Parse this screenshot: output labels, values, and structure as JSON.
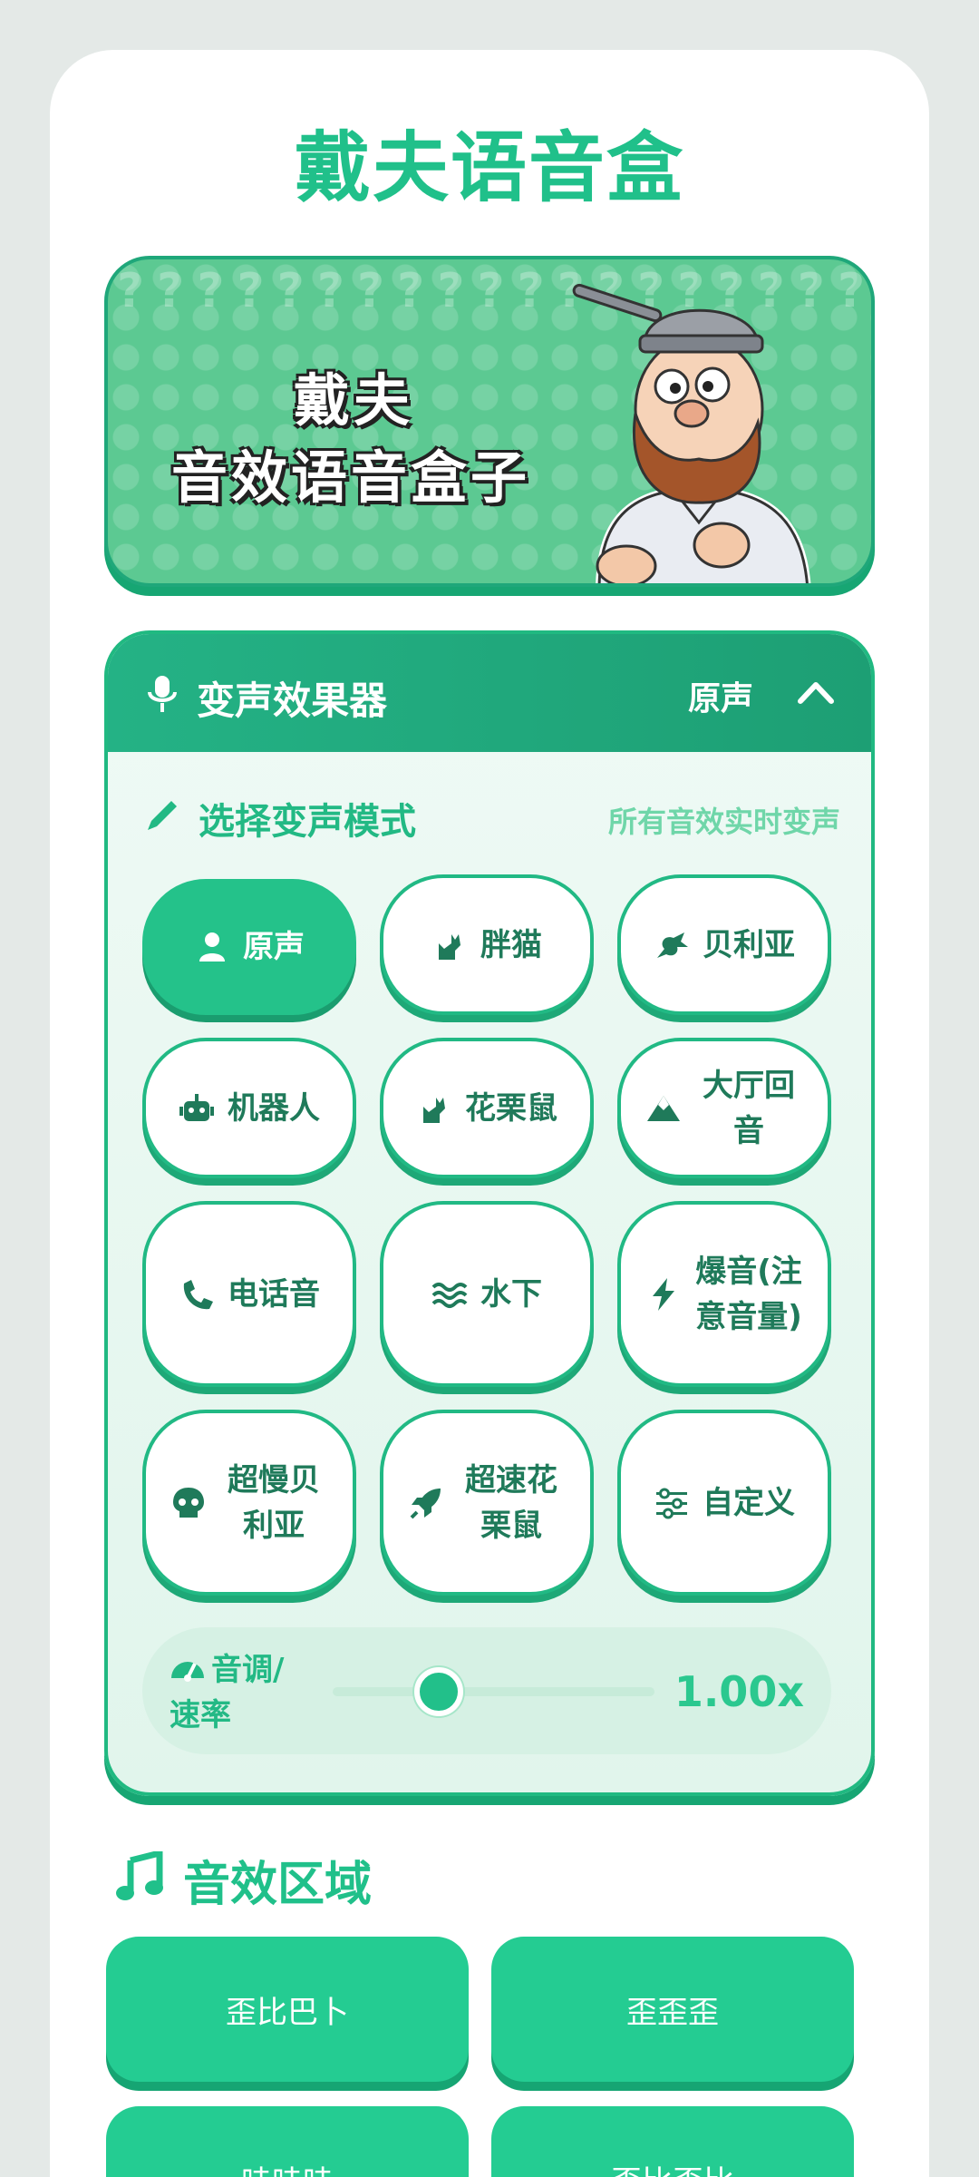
{
  "app": {
    "title": "戴夫语音盒"
  },
  "banner": {
    "line1": "戴夫",
    "line2": "音效语音盒子",
    "pattern": "????????????????????????????????????????????????????????????????????????????????????????????????????????????????????????????????????????????????"
  },
  "voice_changer": {
    "title": "变声效果器",
    "current_mode": "原声",
    "section_title": "选择变声模式",
    "section_hint": "所有音效实时变声",
    "modes": [
      {
        "label": "原声",
        "icon": "person-icon",
        "active": true
      },
      {
        "label": "胖猫",
        "icon": "cat-icon",
        "active": false
      },
      {
        "label": "贝利亚",
        "icon": "dragon-icon",
        "active": false
      },
      {
        "label": "机器人",
        "icon": "robot-icon",
        "active": false
      },
      {
        "label": "花栗鼠",
        "icon": "cat-icon",
        "active": false
      },
      {
        "label": "大厅回音",
        "icon": "mountain-icon",
        "active": false
      },
      {
        "label": "电话音",
        "icon": "phone-icon",
        "active": false
      },
      {
        "label": "水下",
        "icon": "water-icon",
        "active": false
      },
      {
        "label": "爆音(注意音量)",
        "icon": "bolt-icon",
        "active": false
      },
      {
        "label": "超慢贝利亚",
        "icon": "skull-icon",
        "active": false
      },
      {
        "label": "超速花栗鼠",
        "icon": "rocket-icon",
        "active": false
      },
      {
        "label": "自定义",
        "icon": "sliders-icon",
        "active": false
      }
    ],
    "pitch": {
      "label": "音调/速率",
      "value_text": "1.00x",
      "fraction": 0.33
    }
  },
  "effects": {
    "title": "音效区域",
    "buttons": [
      "歪比巴卜",
      "歪歪歪",
      "哇哇哇",
      "歪比歪比"
    ]
  },
  "colors": {
    "accent": "#20c08a",
    "accent_dark": "#1d9f74",
    "panel_bg": "#e1f5ec"
  }
}
